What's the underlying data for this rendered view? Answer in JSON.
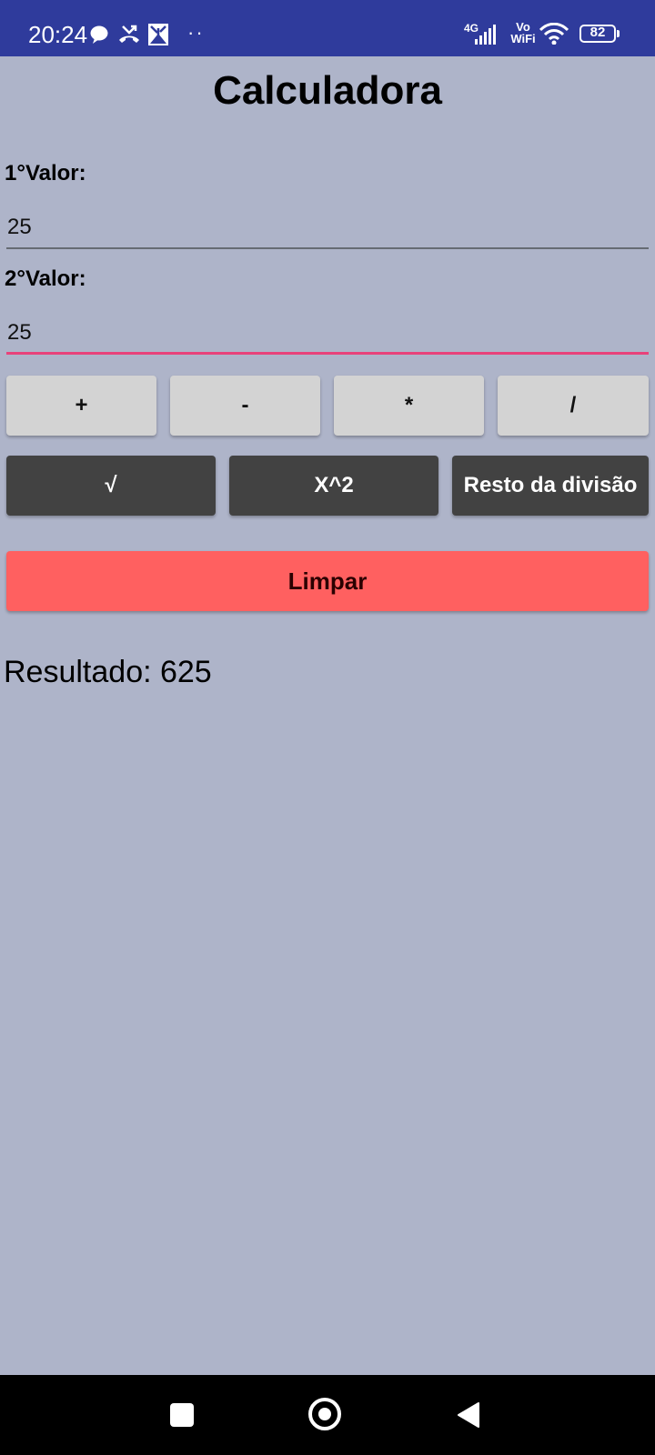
{
  "status_bar": {
    "time": "20:24",
    "network_label": "4G",
    "vowifi_label": "Vo WiFi",
    "battery_level": "82",
    "background_color": "#2f3b9c",
    "icons": [
      "chat-bubble-icon",
      "missed-call-icon",
      "image-notification-icon",
      "more-notifications-dots",
      "signal-bars-icon",
      "wifi-icon",
      "battery-icon"
    ]
  },
  "app": {
    "title": "Calculadora",
    "background_color": "#aeb4c9"
  },
  "form": {
    "label_1": "1°Valor:",
    "value_1": "25",
    "label_2": "2°Valor:",
    "value_2": "25",
    "focused_underline_color": "#e8427a"
  },
  "operations": {
    "add": "+",
    "subtract": "-",
    "multiply": "*",
    "divide": "/",
    "sqrt": "√",
    "square": "X^2",
    "remainder": "Resto da divisão"
  },
  "clear_button": {
    "label": "Limpar",
    "color": "#ff6060"
  },
  "result": {
    "text": "Resultado: 625"
  },
  "nav_bar": {
    "icons": [
      "recent-apps-icon",
      "home-icon",
      "back-icon"
    ]
  }
}
